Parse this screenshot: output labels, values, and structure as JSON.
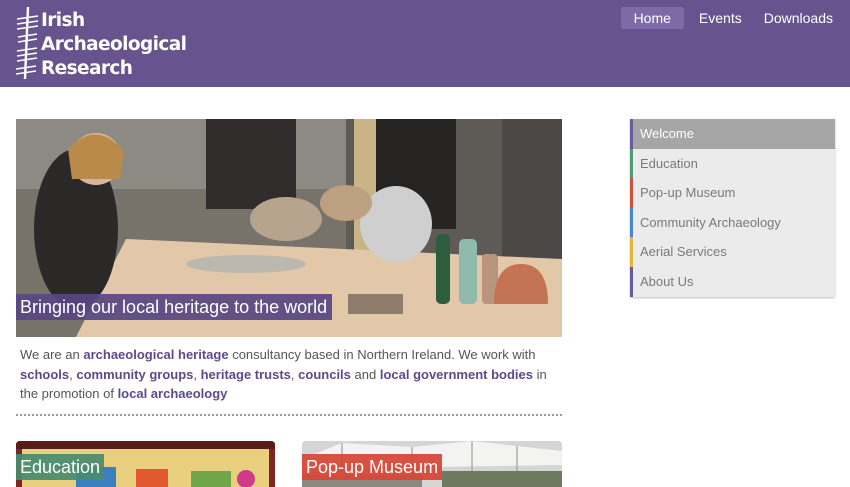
{
  "site": {
    "title_lines": [
      "Irish",
      "Archaeological",
      "Research"
    ]
  },
  "nav": {
    "items": [
      {
        "label": "Home",
        "active": true
      },
      {
        "label": "Events",
        "active": false
      },
      {
        "label": "Downloads",
        "active": false
      }
    ]
  },
  "hero": {
    "caption": "Bringing our local heritage to the world"
  },
  "intro": {
    "t1": "We are an ",
    "k1": "archaeological heritage",
    "t2": " consultancy based in Northern Ireland. We work with ",
    "k2": "schools",
    "t3": ", ",
    "k3": "community groups",
    "t4": ", ",
    "k4": "heritage trusts",
    "t5": ", ",
    "k5": "councils",
    "t6": " and ",
    "k6": "local government bodies",
    "t7": " in the promotion of ",
    "k7": "local archaeology"
  },
  "tiles": [
    {
      "label": "Education",
      "color": "#488c6c"
    },
    {
      "label": "Pop-up Museum",
      "color": "#d64838"
    }
  ],
  "sidebar": {
    "items": [
      {
        "label": "Welcome",
        "active": true,
        "accent": "#6a5a9a"
      },
      {
        "label": "Education",
        "active": false,
        "accent": "#4f9a72"
      },
      {
        "label": "Pop-up Museum",
        "active": false,
        "accent": "#d0513f"
      },
      {
        "label": "Community Archaeology",
        "active": false,
        "accent": "#4a86c8"
      },
      {
        "label": "Aerial Services",
        "active": false,
        "accent": "#e0b63c"
      },
      {
        "label": "About Us",
        "active": false,
        "accent": "#6a5a9a"
      }
    ]
  },
  "colors": {
    "header_bg": "#67548f",
    "link": "#5d4a8c"
  }
}
